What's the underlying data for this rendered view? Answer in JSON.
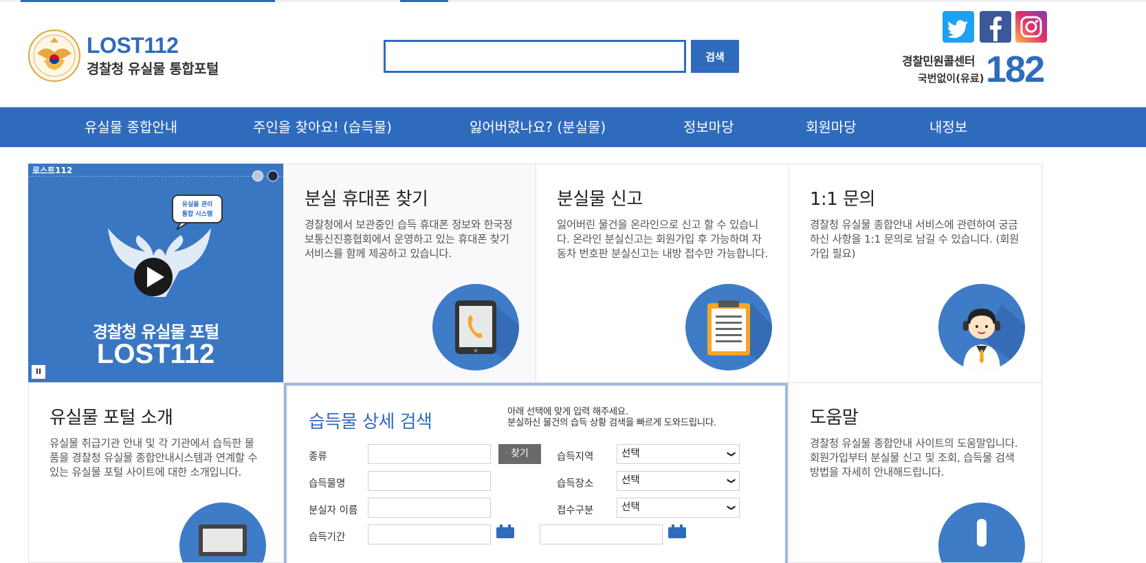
{
  "header": {
    "logo_title": "LOST112",
    "logo_subtitle": "경찰청 유실물 통합포털",
    "search_button": "검색",
    "search_placeholder": "",
    "call_center_label": "경찰민원콜센터",
    "call_center_sub": "국번없이(유료)",
    "call_center_number": "182",
    "sns": [
      {
        "icon": "twitter-icon",
        "color": "#1da1f2"
      },
      {
        "icon": "facebook-icon",
        "color": "#3b5998"
      },
      {
        "icon": "instagram-icon",
        "color": "#d6249f"
      }
    ]
  },
  "nav": {
    "items": [
      {
        "label": "유실물 종합안내"
      },
      {
        "label": "주인을 찾아요! (습득물)"
      },
      {
        "label": "잃어버렸나요? (분실물)"
      },
      {
        "label": "정보마당"
      },
      {
        "label": "회원마당"
      },
      {
        "label": "내정보"
      }
    ]
  },
  "video": {
    "tag": "로스트112",
    "bubble": "유실물 관리\n통합 시스템",
    "title_line1": "경찰청 유실물 포털",
    "title_line2": "LOST112",
    "pause_label": "II"
  },
  "cards": [
    {
      "title": "분실 휴대폰 찾기",
      "desc": "경찰청에서 보관중인 습득 휴대폰 정보와 한국정보통신진흥협회에서 운영하고 있는 휴대폰 찾기 서비스를 함께 제공하고 있습니다.",
      "icon": "phone-tablet-icon"
    },
    {
      "title": "분실물 신고",
      "desc": "잃어버린 물건을 온라인으로 신고 할 수 있습니다. 온라인 분실신고는 회원가입 후 가능하며 자동차 번호판 분실신고는 내방 접수만 가능합니다.",
      "icon": "clipboard-icon"
    },
    {
      "title": "1:1 문의",
      "desc": "경찰청 유실물 종합안내 서비스에 관련하여 궁금하신 사항을 1:1 문의로 남길 수 있습니다. (회원가입 필요)",
      "icon": "support-agent-icon"
    },
    {
      "title": "유실물 포털 소개",
      "desc": "유실물 취급기관 안내 및 각 기관에서 습득한 물품을 경찰청 유실물 종합안내시스템과 연계할 수 있는 유실물 포털 사이트에 대한 소개입니다.",
      "icon": "monitor-icon"
    },
    {
      "title": "도움말",
      "desc": "경찰청 유실물 종합안내 사이트의 도움말입니다. 회원가입부터 분실물 신고 및 조회, 습득물 검색 방법을 자세히 안내해드립니다.",
      "icon": "info-icon"
    }
  ],
  "detail_search": {
    "title": "습득물 상세 검색",
    "desc_line1": "아래 선택에 맞게 입력 해주세요.",
    "desc_line2": "분실하신 물건의 습득 상황 검색을 빠르게 도와드립니다.",
    "find_button": "찾기",
    "left_labels": [
      "종류",
      "습득물명",
      "분실자 이름",
      "습득기간"
    ],
    "right_labels": [
      "습득지역",
      "습득장소",
      "접수구분"
    ],
    "select_value": "선택"
  },
  "colors": {
    "primary": "#2f6bbd",
    "nav_bg": "#2f6bbd",
    "circle": "#3f7cc7"
  }
}
